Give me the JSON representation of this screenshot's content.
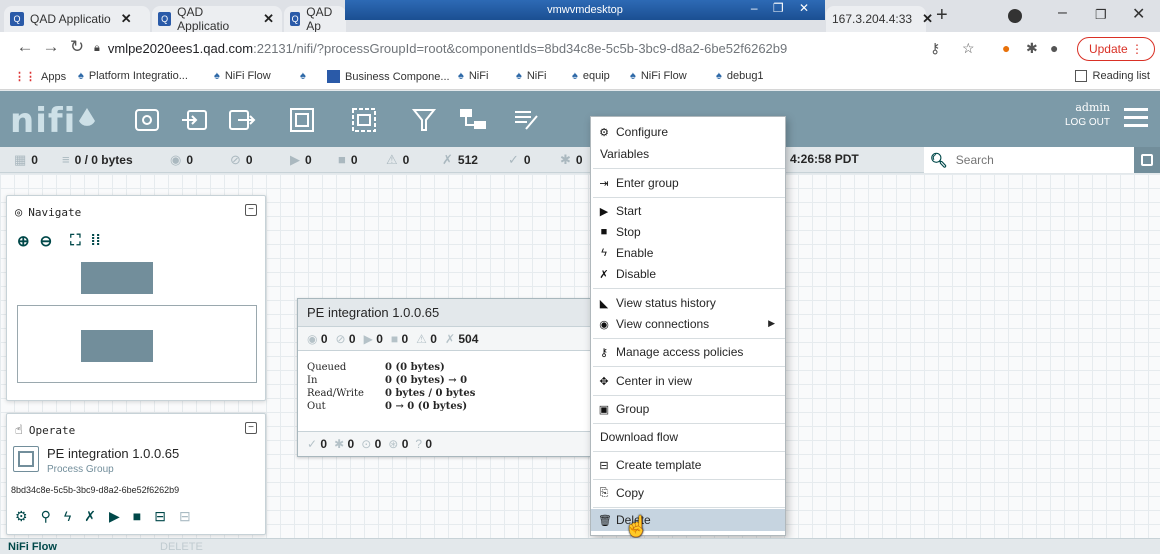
{
  "browser": {
    "tabs": [
      {
        "label": "QAD Applicatio",
        "active": false
      },
      {
        "label": "QAD Applicatio",
        "active": true
      },
      {
        "label": "QAD Ap",
        "active": false
      },
      {
        "label": "167.3.204.4:33",
        "active": false
      }
    ],
    "vm_bar_title": "vmwvmdesktop",
    "url_host": "vmlpe2020ees1.qad.com",
    "url_path": ":22131/nifi/?processGroupId=root&componentIds=8bd34c8e-5c5b-3bc9-d8a2-6be52f6262b9",
    "update_label": "Update",
    "bookmarks": [
      "Apps",
      "Platform Integratio...",
      "NiFi Flow",
      "",
      "Business Compone...",
      "NiFi",
      "NiFi",
      "equip",
      "NiFi Flow",
      "debug1"
    ],
    "reading_list_label": "Reading list"
  },
  "header": {
    "logo": "nifi",
    "user": "admin",
    "logout": "LOG OUT"
  },
  "status": {
    "active_threads": "0",
    "queued": "0 / 0 bytes",
    "transmitting": "0",
    "not_transmitting": "0",
    "running": "0",
    "stopped": "0",
    "invalid": "0",
    "disabled": "512",
    "up_to_date": "0",
    "locally_modified": "0",
    "last_refreshed": "4:26:58 PDT",
    "search_placeholder": "Search"
  },
  "navigate": {
    "title": "Navigate"
  },
  "operate": {
    "title": "Operate",
    "name": "PE integration 1.0.0.65",
    "type": "Process Group",
    "id": "8bd34c8e-5c5b-3bc9-d8a2-6be52f6262b9"
  },
  "process_group": {
    "title": "PE integration 1.0.0.65",
    "stats": {
      "transmitting": "0",
      "not_transmitting": "0",
      "running": "0",
      "stopped": "0",
      "invalid": "0",
      "disabled": "504"
    },
    "rows": [
      {
        "label": "Queued",
        "value": "0 (0 bytes)"
      },
      {
        "label": "In",
        "value": "0 (0 bytes) → 0"
      },
      {
        "label": "Read/Write",
        "value": "0 bytes / 0 bytes"
      },
      {
        "label": "Out",
        "value": "0 → 0 (0 bytes)"
      }
    ],
    "footer": {
      "up_to_date": "0",
      "locally_modified": "0",
      "stale": "0",
      "modified_stale": "0",
      "sync_failure": "0"
    }
  },
  "context_menu": {
    "items": [
      {
        "label": "Configure",
        "icon": "gear-icon"
      },
      {
        "label": "Variables",
        "icon": ""
      },
      {
        "label": "Enter group",
        "icon": "enter-icon"
      },
      {
        "label": "Start",
        "icon": "play-icon"
      },
      {
        "label": "Stop",
        "icon": "stop-icon"
      },
      {
        "label": "Enable",
        "icon": "bolt-icon"
      },
      {
        "label": "Disable",
        "icon": "disable-icon"
      },
      {
        "label": "View status history",
        "icon": "chart-icon"
      },
      {
        "label": "View connections",
        "icon": "connections-icon"
      },
      {
        "label": "Manage access policies",
        "icon": "key-icon"
      },
      {
        "label": "Center in view",
        "icon": "crosshair-icon"
      },
      {
        "label": "Group",
        "icon": "group-icon"
      },
      {
        "label": "Download flow",
        "icon": ""
      },
      {
        "label": "Create template",
        "icon": "template-icon"
      },
      {
        "label": "Copy",
        "icon": "copy-icon"
      },
      {
        "label": "Delete",
        "icon": "trash-icon"
      }
    ]
  },
  "footer": {
    "breadcrumb": "NiFi Flow",
    "ghost_label": "DELETE"
  }
}
